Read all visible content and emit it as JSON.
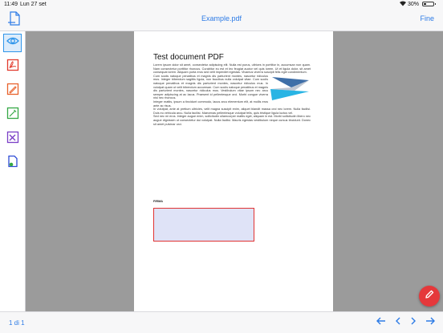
{
  "status": {
    "time": "11:49",
    "date": "Lun 27 set",
    "battery": "30%",
    "battery_level": 0.3
  },
  "nav": {
    "title": "Example.pdf",
    "done_label": "Fine",
    "file_icon": "document-icon"
  },
  "toolbar": {
    "tools": [
      {
        "name": "view",
        "icon": "eye-icon",
        "color": "#2f95ea",
        "active": true
      },
      {
        "name": "pdf",
        "icon": "pdf-icon",
        "color": "#e23b2e",
        "active": false
      },
      {
        "name": "annotate",
        "icon": "pencil-square-icon",
        "color": "#e8622c",
        "active": false
      },
      {
        "name": "edit",
        "icon": "pen-icon",
        "color": "#35a845",
        "active": false
      },
      {
        "name": "tools",
        "icon": "wrench-icon",
        "color": "#7a3fc7",
        "active": false
      },
      {
        "name": "document",
        "icon": "document-check-icon",
        "color": "#2d4bd6",
        "active": false
      }
    ]
  },
  "document": {
    "heading": "Test document PDF",
    "paragraphs": [
      "Lorem ipsum dolor sit amet, consectetur adipiscing elit. Nulla est purus, ultrices in porttitor in, accumsan non quam. Nam consectetur porttitor rhoncus. Curabitur eu est et leo feugiat auctor vel quis lorem. Ut et ligula dolor, sit amet consequat lorem. Aliquam porta eros sed velit imperdiet egestas. Vivamus viverra suscipit felis eget condimentum.",
      "Cum sociis natoque penatibus et magnis dis parturient montes, nascetur ridiculus mus. Integer bibendum sagittis ligula, non faucibus nulla volutpat vitae. Cum sociis natoque penatibus et magnis dis parturient montes, nascetur ridiculus mus. In volutpat quam ut velit bibendum accumsan. Cum sociis natoque penatibus et magnis dis parturient montes, nascetur ridiculus mus. Vestibulum vitae ipsum nec arcu semper adipiscing at ac lacus. Praesent id pellentesque orci. Morbi congue viverra nisl nec rhoncus.",
      "Integer mattis, ipsum a tincidunt commodo, lacus arcu elementum elit, at mollis eros ante ac risus.",
      "In volutpat, ante at pretium ultricies, velit magna suscipit enim, aliquet blandit massa orci nec lorem. Nulla facilisi. Duis eu vehicula arcu. Nulla facilisi. Maecenas pellentesque volutpat felis, quis tristique ligula luctus vel.",
      "Sed nec mi eros. Integer augue enim, sollicitudin ullamcorper mattis eget, aliquam in est. Morbi sollicitudin libero nec augue dignissim ut consectetur dui volutpat. Nulla facilisi. Mauris egestas vestibulum neque cursus tincidunt. Donec sit amet pulvinar orci."
    ],
    "signature_label": "FIRMA"
  },
  "actions": {
    "edit_icon": "pencil-icon",
    "fab_color": "#e5383b"
  },
  "pager": {
    "page_info": "1 di 1",
    "first_icon": "arrow-first-icon",
    "prev_icon": "chevron-left-icon",
    "next_icon": "chevron-right-icon",
    "last_icon": "arrow-last-icon"
  },
  "accent": "#2d7be6"
}
